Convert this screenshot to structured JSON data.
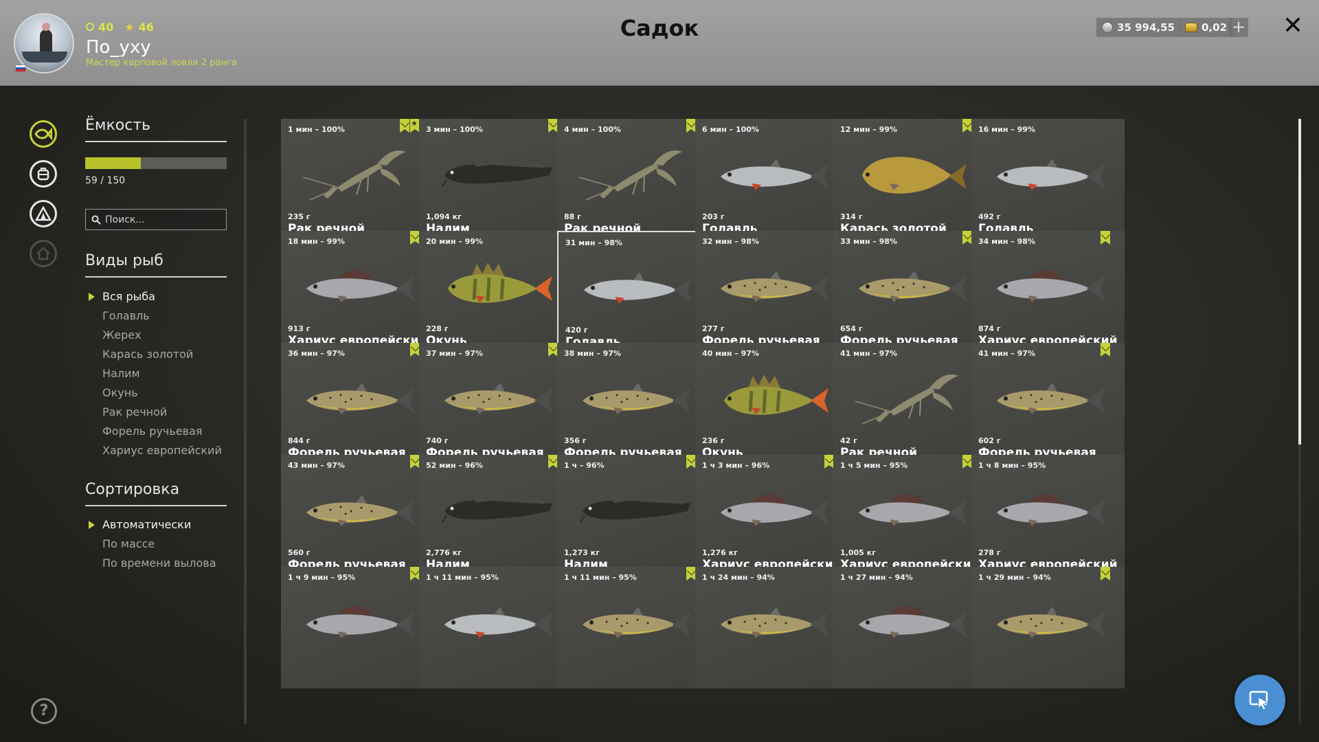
{
  "header": {
    "title": "Садок",
    "player": {
      "stat_ring": "40",
      "stat_star": "46",
      "username": "По_уху",
      "rank": "Мастер карповой ловли 2 ранга"
    },
    "silver": "35 994,55",
    "gold": "0,02",
    "plus_label": "+",
    "close_label": "✕"
  },
  "capacity": {
    "title": "Ёмкость",
    "current": 59,
    "max": 150,
    "label": "59 / 150"
  },
  "search": {
    "placeholder": "Поиск..."
  },
  "species": {
    "title": "Виды рыб",
    "items": [
      "Вся рыба",
      "Голавль",
      "Жерех",
      "Карась золотой",
      "Налим",
      "Окунь",
      "Рак речной",
      "Форель ручьевая",
      "Хариус европейский"
    ],
    "selected_index": 0
  },
  "sorting": {
    "title": "Сортировка",
    "items": [
      "Автоматически",
      "По массе",
      "По времени вылова"
    ],
    "selected_index": 0
  },
  "help_label": "?",
  "catches": [
    {
      "time": "1 мин – 100%",
      "weight": "235 г",
      "name": "Рак речной",
      "kind": "crayfish",
      "bookmark": true,
      "star": true
    },
    {
      "time": "3 мин – 100%",
      "weight": "1,094 кг",
      "name": "Налим",
      "kind": "burbot",
      "bookmark": true
    },
    {
      "time": "4 мин – 100%",
      "weight": "88 г",
      "name": "Рак речной",
      "kind": "crayfish",
      "bookmark": true
    },
    {
      "time": "6 мин – 100%",
      "weight": "203 г",
      "name": "Голавль",
      "kind": "chub",
      "bookmark": false
    },
    {
      "time": "12 мин – 99%",
      "weight": "314 г",
      "name": "Карась золотой",
      "kind": "carp",
      "bookmark": true
    },
    {
      "time": "16 мин – 99%",
      "weight": "492 г",
      "name": "Голавль",
      "kind": "chub",
      "bookmark": false
    },
    {
      "time": "18 мин – 99%",
      "weight": "913 г",
      "name": "Хариус европейский",
      "kind": "grayling",
      "bookmark": true
    },
    {
      "time": "20 мин – 99%",
      "weight": "228 г",
      "name": "Окунь",
      "kind": "perch",
      "bookmark": false
    },
    {
      "time": "31 мин – 98%",
      "weight": "420 г",
      "name": "Голавль",
      "kind": "chub",
      "bookmark": false,
      "selected": true
    },
    {
      "time": "32 мин – 98%",
      "weight": "277 г",
      "name": "Форель ручьевая",
      "kind": "trout",
      "bookmark": false
    },
    {
      "time": "33 мин – 98%",
      "weight": "654 г",
      "name": "Форель ручьевая",
      "kind": "trout",
      "bookmark": true
    },
    {
      "time": "34 мин – 98%",
      "weight": "874 г",
      "name": "Хариус европейский",
      "kind": "grayling",
      "bookmark": true
    },
    {
      "time": "36 мин – 97%",
      "weight": "844 г",
      "name": "Форель ручьевая",
      "kind": "trout",
      "bookmark": true
    },
    {
      "time": "37 мин – 97%",
      "weight": "740 г",
      "name": "Форель ручьевая",
      "kind": "trout",
      "bookmark": true
    },
    {
      "time": "38 мин – 97%",
      "weight": "356 г",
      "name": "Форель ручьевая",
      "kind": "trout",
      "bookmark": false
    },
    {
      "time": "40 мин – 97%",
      "weight": "236 г",
      "name": "Окунь",
      "kind": "perch",
      "bookmark": false
    },
    {
      "time": "41 мин – 97%",
      "weight": "42 г",
      "name": "Рак речной",
      "kind": "crayfish",
      "bookmark": false
    },
    {
      "time": "41 мин – 97%",
      "weight": "602 г",
      "name": "Форель ручьевая",
      "kind": "trout",
      "bookmark": true
    },
    {
      "time": "43 мин – 97%",
      "weight": "560 г",
      "name": "Форель ручьевая",
      "kind": "trout",
      "bookmark": true
    },
    {
      "time": "52 мин – 96%",
      "weight": "2,776 кг",
      "name": "Налим",
      "kind": "burbot",
      "bookmark": true
    },
    {
      "time": "1 ч – 96%",
      "weight": "1,273 кг",
      "name": "Налим",
      "kind": "burbot",
      "bookmark": true
    },
    {
      "time": "1 ч 3 мин – 96%",
      "weight": "1,276 кг",
      "name": "Хариус европейский",
      "kind": "grayling",
      "bookmark": true
    },
    {
      "time": "1 ч 5 мин – 95%",
      "weight": "1,005 кг",
      "name": "Хариус европейский",
      "kind": "grayling",
      "bookmark": true
    },
    {
      "time": "1 ч 8 мин – 95%",
      "weight": "278 г",
      "name": "Хариус европейский",
      "kind": "grayling",
      "bookmark": false
    },
    {
      "time": "1 ч 9 мин – 95%",
      "weight": "",
      "name": "",
      "kind": "grayling",
      "bookmark": true
    },
    {
      "time": "1 ч 11 мин – 95%",
      "weight": "",
      "name": "",
      "kind": "chub",
      "bookmark": false
    },
    {
      "time": "1 ч 11 мин – 95%",
      "weight": "",
      "name": "",
      "kind": "trout",
      "bookmark": true
    },
    {
      "time": "1 ч 24 мин – 94%",
      "weight": "",
      "name": "",
      "kind": "trout",
      "bookmark": false
    },
    {
      "time": "1 ч 27 мин – 94%",
      "weight": "",
      "name": "",
      "kind": "grayling",
      "bookmark": false
    },
    {
      "time": "1 ч 29 мин – 94%",
      "weight": "",
      "name": "",
      "kind": "trout",
      "bookmark": true
    }
  ],
  "colors": {
    "accent": "#c8d436",
    "chub": "#b9bcbf",
    "trout": "#a89a6a",
    "grayling": "#a6a8ac",
    "perch": "#9a9a3c",
    "carp": "#b89a3c",
    "burbot": "#2c2c26",
    "crayfish": "#8e8a70"
  }
}
